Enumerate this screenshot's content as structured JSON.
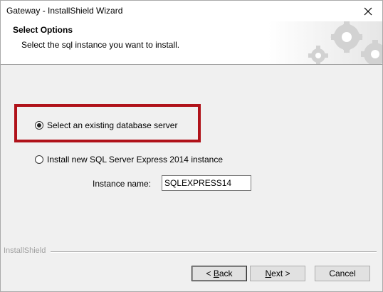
{
  "window": {
    "title": "Gateway - InstallShield Wizard",
    "close_glyph": "✕"
  },
  "header": {
    "title": "Select Options",
    "subtitle": "Select the sql instance you want to install."
  },
  "options": {
    "existing_label": "Select an existing database server",
    "existing_selected": true,
    "new_label": "Install new SQL Server Express 2014 instance",
    "new_selected": false
  },
  "instance": {
    "label": "Instance name:",
    "value": "SQLEXPRESS14"
  },
  "footer": {
    "brand": "InstallShield",
    "back_mnemonic": "B",
    "back_rest": "ack",
    "back_prefix": "< ",
    "next_mnemonic": "N",
    "next_rest": "ext >",
    "cancel_label": "Cancel"
  },
  "colors": {
    "highlight": "#b0121a",
    "window_bg": "#f0f0f0"
  }
}
